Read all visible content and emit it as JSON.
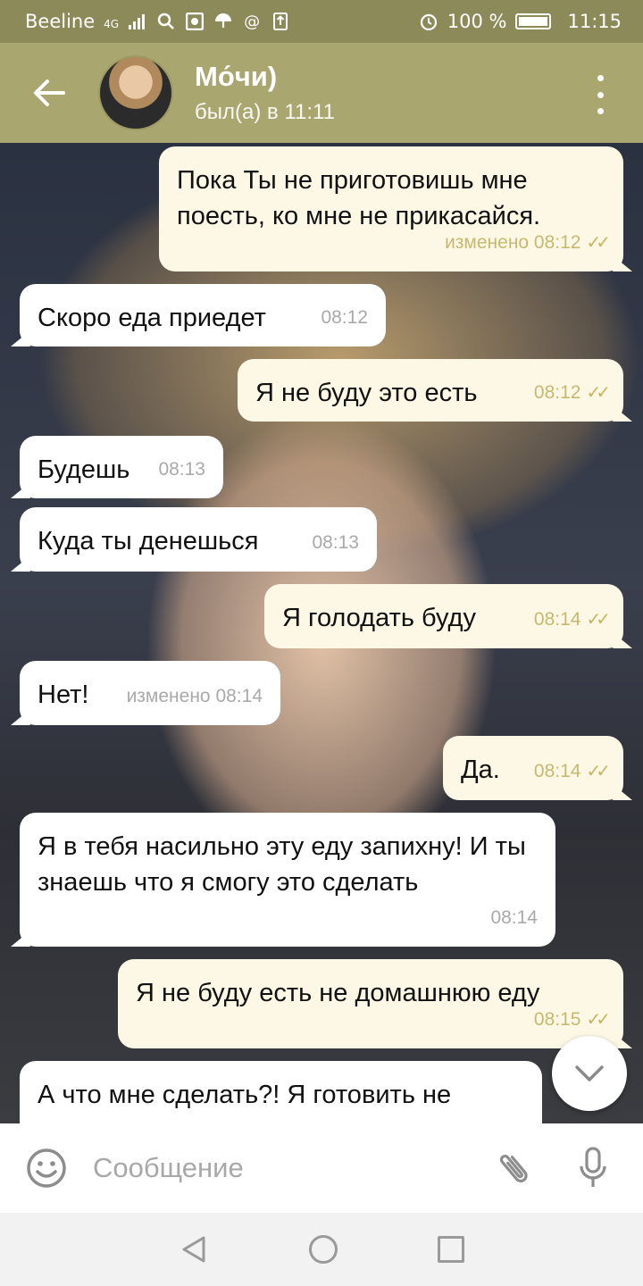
{
  "status_bar": {
    "carrier": "Beeline",
    "network": "4G",
    "battery": "100 %",
    "time": "11:15"
  },
  "header": {
    "contact_name": "Мо́чи)",
    "last_seen": "был(а) в 11:11"
  },
  "messages": [
    {
      "side": "out",
      "text": "Пока Ты не приготовишь мне поесть, ко мне не прикасайся.",
      "meta": "изменено 08:12"
    },
    {
      "side": "in",
      "text": "Скоро еда приедет",
      "meta": "08:12"
    },
    {
      "side": "out",
      "text": "Я не буду это есть",
      "meta": "08:12"
    },
    {
      "side": "in",
      "text": "Будешь",
      "meta": "08:13"
    },
    {
      "side": "in",
      "text": "Куда ты денешься",
      "meta": "08:13"
    },
    {
      "side": "out",
      "text": "Я голодать буду",
      "meta": "08:14"
    },
    {
      "side": "in",
      "text": "Нет!",
      "meta": "изменено 08:14"
    },
    {
      "side": "out",
      "text": "Да.",
      "meta": "08:14"
    },
    {
      "side": "in",
      "text": "Я в тебя насильно эту еду запихну! И ты знаешь что я смогу это сделать",
      "meta": "08:14"
    },
    {
      "side": "out",
      "text": "Я не буду есть не домашнюю еду",
      "meta": "08:15"
    },
    {
      "side": "in",
      "text": "А что мне сделать?! Я готовить не",
      "meta": ""
    }
  ],
  "composer": {
    "placeholder": "Сообщение"
  },
  "colors": {
    "status_bar": "#8d8a5a",
    "header": "#a9a670",
    "bubble_out": "#fdf8e6",
    "bubble_in": "#ffffff",
    "tick": "#c6b55f"
  },
  "icons": [
    "back-arrow-icon",
    "more-vert-icon",
    "emoji-icon",
    "attach-icon",
    "mic-icon",
    "chevron-down-icon",
    "double-check-icon"
  ]
}
